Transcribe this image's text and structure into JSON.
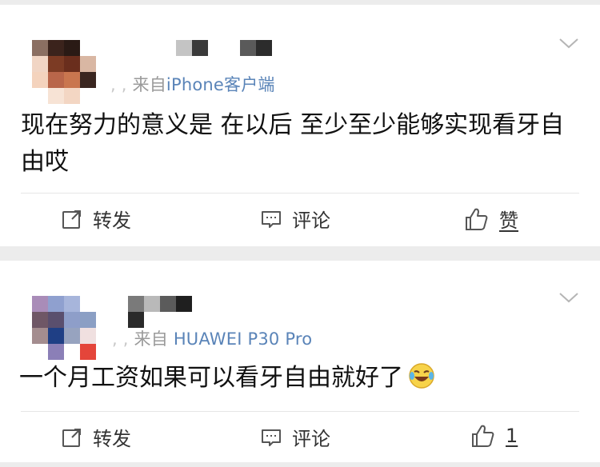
{
  "posts": [
    {
      "source_prefix": "来自",
      "source_device": "iPhone客户端",
      "text": "现在努力的意义是 在以后 至少至少能够实现看牙自由哎",
      "actions": {
        "repost": "转发",
        "comment": "评论",
        "like": "赞"
      }
    },
    {
      "source_prefix": "来自",
      "source_device": "HUAWEI P30 Pro",
      "text": "一个月工资如果可以看牙自由就好了",
      "emoji": "laughing-crying-emoji",
      "actions": {
        "repost": "转发",
        "comment": "评论",
        "like": "1"
      }
    }
  ],
  "colors": {
    "background": "#ececec",
    "card": "#ffffff",
    "source_link": "#5a84b8",
    "text": "#111111",
    "icon": "#555555"
  }
}
